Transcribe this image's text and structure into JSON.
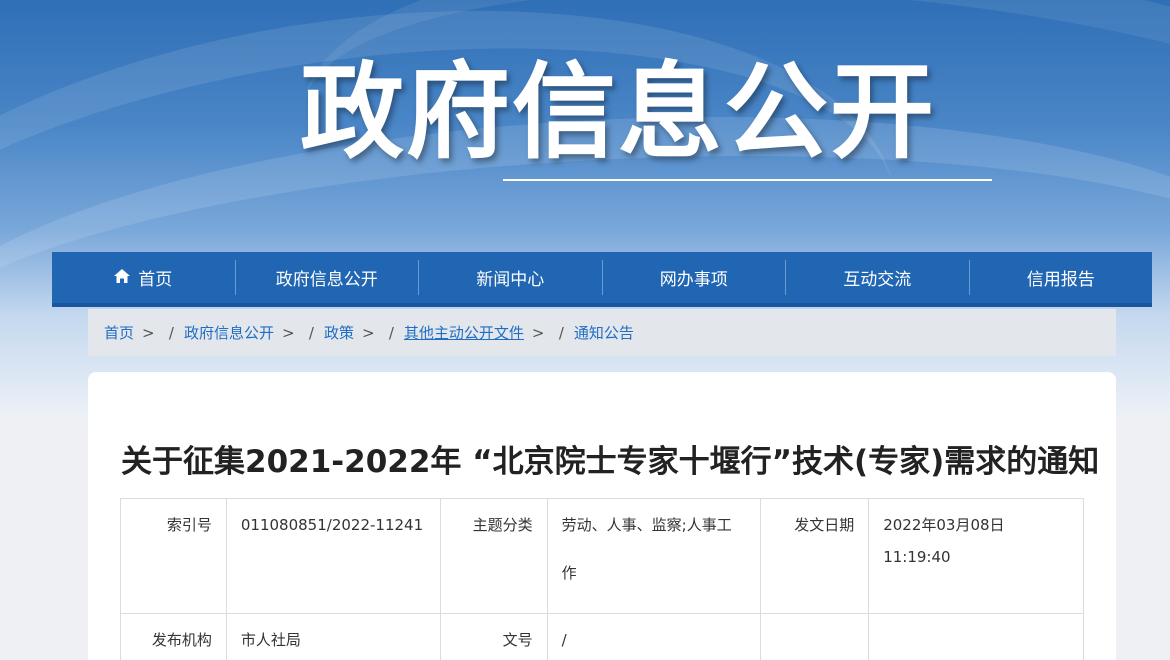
{
  "banner": {
    "title": "政府信息公开"
  },
  "nav": {
    "items": [
      {
        "label": "首页",
        "icon": "home-icon"
      },
      {
        "label": "政府信息公开"
      },
      {
        "label": "新闻中心"
      },
      {
        "label": "网办事项"
      },
      {
        "label": "互动交流"
      },
      {
        "label": "信用报告"
      }
    ]
  },
  "breadcrumb": {
    "items": [
      "首页",
      "政府信息公开",
      "政策",
      "其他主动公开文件",
      "通知公告"
    ],
    "arrow": ">",
    "slash": "/"
  },
  "article": {
    "title": "关于征集2021-2022年 “北京院士专家十堰行”技术(专家)需求的通知",
    "meta": {
      "index_label": "索引号",
      "index_value": "011080851/2022-11241",
      "topic_label": "主题分类",
      "topic_value": "劳动、人事、监察;人事工作",
      "date_label": "发文日期",
      "date_value": "2022年03月08日 11:19:40",
      "org_label": "发布机构",
      "org_value": "市人社局",
      "docno_label": "文号",
      "docno_value": "/"
    }
  }
}
